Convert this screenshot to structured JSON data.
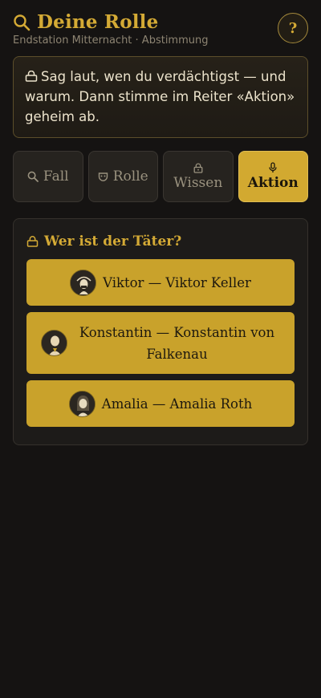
{
  "header": {
    "title": "Deine Rolle",
    "subtitle": "Endstation Mitternacht · Abstimmung",
    "help_label": "?"
  },
  "instruction": {
    "text": "Sag laut, wen du verdächtigst — und warum. Dann stimme im Reiter «Aktion» geheim ab."
  },
  "tabs": [
    {
      "label": "Fall",
      "icon": "search-icon",
      "active": false
    },
    {
      "label": "Rolle",
      "icon": "mask-icon",
      "active": false
    },
    {
      "label": "Wissen",
      "icon": "lock-icon",
      "active": false
    },
    {
      "label": "Aktion",
      "icon": "microphone-icon",
      "active": true
    }
  ],
  "vote": {
    "title": "Wer ist der Täter?",
    "options": [
      {
        "label": "Viktor — Viktor Keller",
        "avatar": "viktor-avatar"
      },
      {
        "label": "Konstantin — Konstantin von Falkenau",
        "avatar": "konstantin-avatar"
      },
      {
        "label": "Amalia — Amalia Roth",
        "avatar": "amalia-avatar"
      }
    ]
  },
  "colors": {
    "background": "#151312",
    "accent": "#d4aa35",
    "button": "#c9a22b"
  }
}
